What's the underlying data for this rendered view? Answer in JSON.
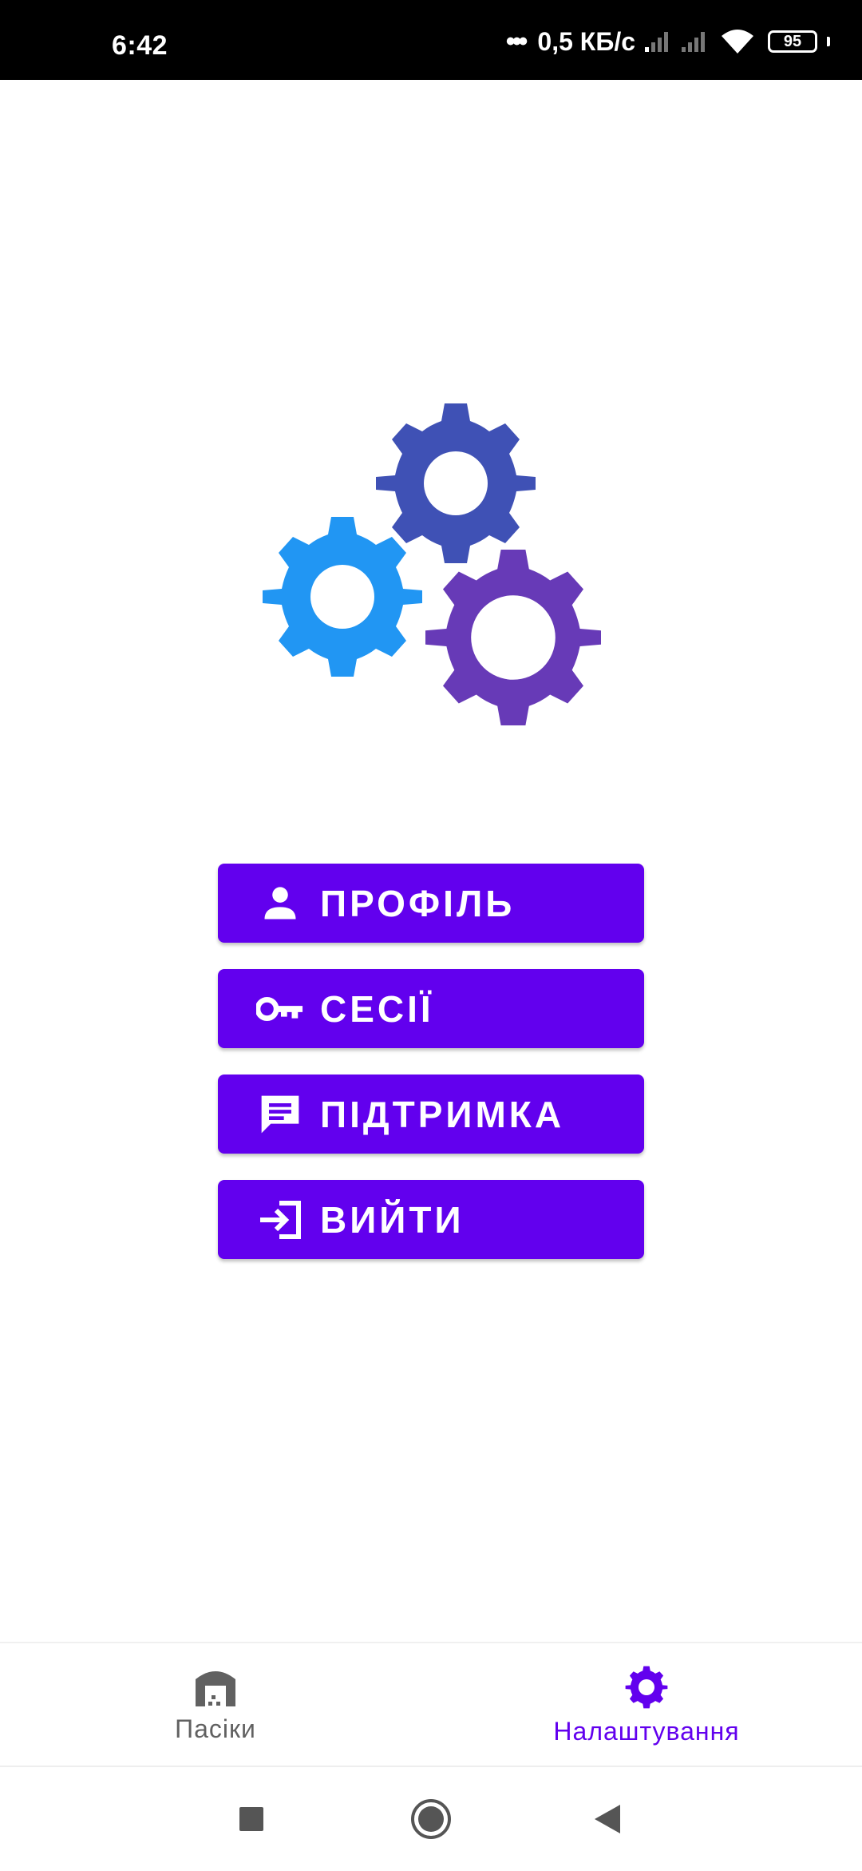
{
  "status_bar": {
    "time": "6:42",
    "dots": "•••",
    "network_speed": "0,5 КБ/с",
    "battery": "95"
  },
  "illustration": {
    "icon": "gears-icon",
    "colors": {
      "top_gear": "#3f51b5",
      "left_gear": "#2196f3",
      "right_gear": "#673ab7"
    }
  },
  "menu": {
    "items": [
      {
        "label": "ПРОФІЛЬ",
        "icon": "person-icon"
      },
      {
        "label": "СЕСІЇ",
        "icon": "key-icon"
      },
      {
        "label": "ПІДТРИМКА",
        "icon": "chat-icon"
      },
      {
        "label": "ВИЙТИ",
        "icon": "logout-icon"
      }
    ],
    "button_color": "#6200ee"
  },
  "bottom_nav": {
    "items": [
      {
        "label": "Пасіки",
        "icon": "apiary-icon",
        "active": false
      },
      {
        "label": "Налаштування",
        "icon": "gear-icon",
        "active": true
      }
    ],
    "active_color": "#6200ee",
    "inactive_color": "#616161"
  },
  "system_nav": {
    "buttons": [
      "recents-icon",
      "home-icon",
      "back-icon"
    ]
  }
}
